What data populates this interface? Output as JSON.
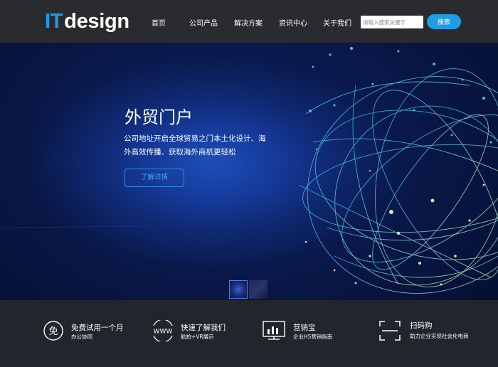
{
  "header": {
    "logo_it": "IT",
    "logo_design": "design",
    "nav": [
      "首页",
      "公司产品",
      "解决方案",
      "资讯中心",
      "关于我们"
    ],
    "search_placeholder": "请输入搜索关键字",
    "search_button": "搜索"
  },
  "banner": {
    "title": "外贸门户",
    "description": "公司地址开启全球贸易之门本土化设计、海外高效传播、获取海外商机更轻松",
    "button": "了解详情"
  },
  "features": [
    {
      "icon_text": "免",
      "title": "免费试用一个月",
      "subtitle": "办公协同"
    },
    {
      "icon_text": "WWW",
      "title": "快速了解我们",
      "subtitle": "航拍+VR展示"
    },
    {
      "title": "营销宝",
      "subtitle": "企业H5营销指南"
    },
    {
      "title": "扫码购",
      "subtitle": "助力企业实现社会化电商"
    }
  ],
  "colors": {
    "accent": "#1f9ee7",
    "header_bg": "#2a2b2f",
    "footer_bg": "#23252c"
  }
}
